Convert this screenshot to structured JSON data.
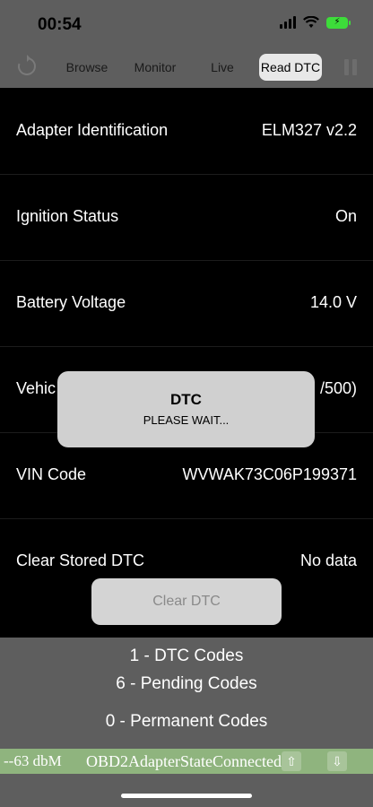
{
  "status_bar": {
    "time": "00:54",
    "battery_color": "#3ddc3a"
  },
  "toolbar": {
    "tabs": [
      {
        "label": "Browse",
        "active": false
      },
      {
        "label": "Monitor",
        "active": false
      },
      {
        "label": "Live",
        "active": false
      },
      {
        "label": "Read DTC",
        "active": true
      }
    ],
    "refresh_icon": "refresh-icon",
    "pause_icon": "pause-icon"
  },
  "rows": [
    {
      "label": "Adapter Identification",
      "value": "ELM327 v2.2"
    },
    {
      "label": "Ignition Status",
      "value": "On"
    },
    {
      "label": "Battery Voltage",
      "value": "14.0 V"
    },
    {
      "label": "Vehic",
      "value": "/500)"
    },
    {
      "label": "VIN Code",
      "value": "WVWAK73C06P199371"
    },
    {
      "label": "Clear Stored DTC",
      "value": "No data"
    }
  ],
  "clear_button": {
    "label": "Clear DTC"
  },
  "summary": {
    "dtc_codes": "1 - DTC Codes",
    "pending_codes": "6 - Pending Codes",
    "permanent_codes": "0 - Permanent Codes"
  },
  "footer": {
    "signal": "--63 dbM",
    "state": "OBD2AdapterStateConnected",
    "bar_color": "#8fb47e"
  },
  "dialog": {
    "title": "DTC",
    "message": "PLEASE WAIT..."
  }
}
